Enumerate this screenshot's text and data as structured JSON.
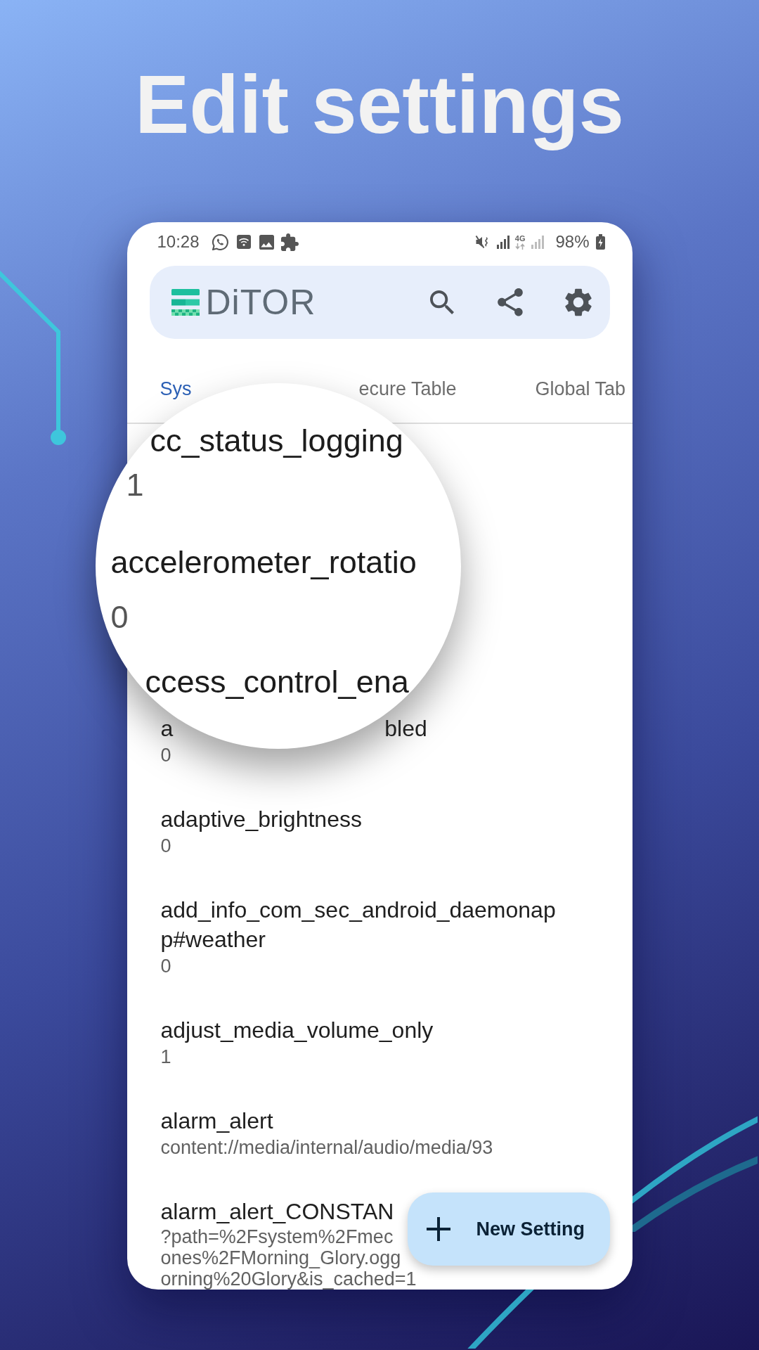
{
  "headline": "Edit settings",
  "status_bar": {
    "time": "10:28",
    "network": "4G",
    "battery": "98%"
  },
  "app_bar": {
    "logo_text": "DiTOR"
  },
  "tabs": [
    {
      "label": "Sys",
      "selected": true
    },
    {
      "label": "ecure Table",
      "selected": false
    },
    {
      "label": "Global Tab",
      "selected": false
    }
  ],
  "magnifier": {
    "items": [
      {
        "name": "cc_status_logging",
        "value": "1"
      },
      {
        "name": "accelerometer_rotatio",
        "value": "0"
      },
      {
        "name": "ccess_control_ena"
      }
    ]
  },
  "settings": [
    {
      "kind": "split",
      "name_start": "a",
      "name_end": "bled",
      "value": "0"
    },
    {
      "kind": "plain",
      "name": "adaptive_brightness",
      "value": "0"
    },
    {
      "kind": "plain",
      "name": "add_info_com_sec_android_daemonapp#weather",
      "value": "0"
    },
    {
      "kind": "plain",
      "name": "adjust_media_volume_only",
      "value": "1"
    },
    {
      "kind": "plain",
      "name": "alarm_alert",
      "value": "content://media/internal/audio/media/93"
    },
    {
      "kind": "multiline",
      "name": "alarm_alert_CONSTAN",
      "value_lines": [
        "?path=%2Fsystem%2Fmec",
        "ones%2FMorning_Glory.ogg",
        "orning%20Glory&is_cached=1"
      ]
    }
  ],
  "fab": {
    "label": "New Setting"
  }
}
